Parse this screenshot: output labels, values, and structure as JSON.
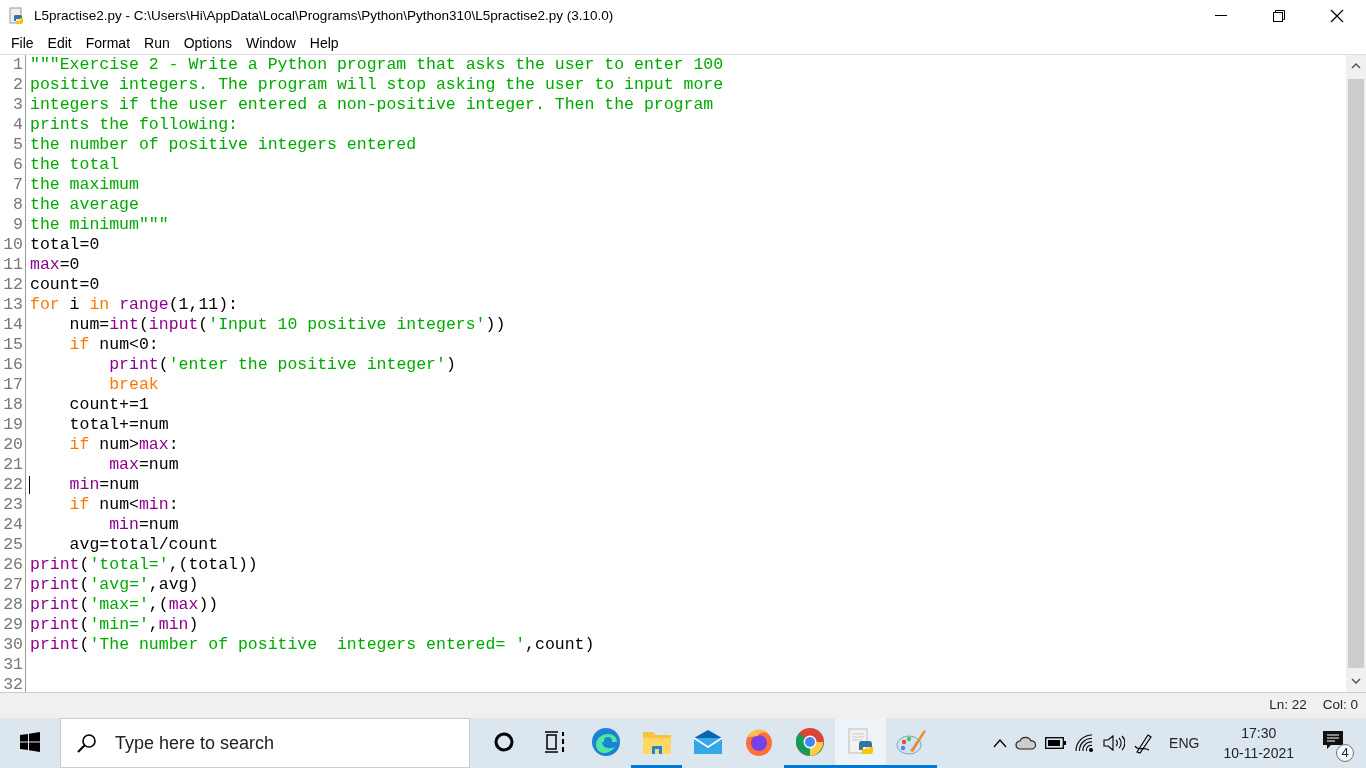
{
  "window": {
    "title": "L5practise2.py - C:\\Users\\Hi\\AppData\\Local\\Programs\\Python\\Python310\\L5practise2.py (3.10.0)"
  },
  "menu": [
    "File",
    "Edit",
    "Format",
    "Run",
    "Options",
    "Window",
    "Help"
  ],
  "editor": {
    "lines": [
      {
        "number": "1",
        "cursor": false,
        "tokens": [
          {
            "kind": "string",
            "text": "\"\"\"Exercise 2 - Write a Python program that asks the user to enter 100"
          }
        ]
      },
      {
        "number": "2",
        "cursor": false,
        "tokens": [
          {
            "kind": "string",
            "text": "positive integers. The program will stop asking the user to input more"
          }
        ]
      },
      {
        "number": "3",
        "cursor": false,
        "tokens": [
          {
            "kind": "string",
            "text": "integers if the user entered a non-positive integer. Then the program"
          }
        ]
      },
      {
        "number": "4",
        "cursor": false,
        "tokens": [
          {
            "kind": "string",
            "text": "prints the following:"
          }
        ]
      },
      {
        "number": "5",
        "cursor": false,
        "tokens": [
          {
            "kind": "string",
            "text": "the number of positive integers entered"
          }
        ]
      },
      {
        "number": "6",
        "cursor": false,
        "tokens": [
          {
            "kind": "string",
            "text": "the total"
          }
        ]
      },
      {
        "number": "7",
        "cursor": false,
        "tokens": [
          {
            "kind": "string",
            "text": "the maximum"
          }
        ]
      },
      {
        "number": "8",
        "cursor": false,
        "tokens": [
          {
            "kind": "string",
            "text": "the average"
          }
        ]
      },
      {
        "number": "9",
        "cursor": false,
        "tokens": [
          {
            "kind": "string",
            "text": "the minimum\"\"\""
          }
        ]
      },
      {
        "number": "10",
        "cursor": false,
        "tokens": [
          {
            "kind": "plain",
            "text": "total=0"
          }
        ]
      },
      {
        "number": "11",
        "cursor": false,
        "tokens": [
          {
            "kind": "builtin",
            "text": "max"
          },
          {
            "kind": "plain",
            "text": "=0"
          }
        ]
      },
      {
        "number": "12",
        "cursor": false,
        "tokens": [
          {
            "kind": "plain",
            "text": "count=0"
          }
        ]
      },
      {
        "number": "13",
        "cursor": false,
        "tokens": [
          {
            "kind": "keyword",
            "text": "for"
          },
          {
            "kind": "plain",
            "text": " i "
          },
          {
            "kind": "keyword",
            "text": "in"
          },
          {
            "kind": "builtin",
            "text": " range"
          },
          {
            "kind": "plain",
            "text": "(1,11):"
          }
        ]
      },
      {
        "number": "14",
        "cursor": false,
        "tokens": [
          {
            "kind": "plain",
            "text": "    num="
          },
          {
            "kind": "builtin",
            "text": "int"
          },
          {
            "kind": "plain",
            "text": "("
          },
          {
            "kind": "builtin",
            "text": "input"
          },
          {
            "kind": "plain",
            "text": "("
          },
          {
            "kind": "string",
            "text": "'Input 10 positive integers'"
          },
          {
            "kind": "plain",
            "text": "))"
          }
        ]
      },
      {
        "number": "15",
        "cursor": false,
        "tokens": [
          {
            "kind": "keyword",
            "text": "    if"
          },
          {
            "kind": "plain",
            "text": " num<0:"
          }
        ]
      },
      {
        "number": "16",
        "cursor": false,
        "tokens": [
          {
            "kind": "builtin",
            "text": "        print"
          },
          {
            "kind": "plain",
            "text": "("
          },
          {
            "kind": "string",
            "text": "'enter the positive integer'"
          },
          {
            "kind": "plain",
            "text": ")"
          }
        ]
      },
      {
        "number": "17",
        "cursor": false,
        "tokens": [
          {
            "kind": "keyword",
            "text": "        break"
          }
        ]
      },
      {
        "number": "18",
        "cursor": false,
        "tokens": [
          {
            "kind": "plain",
            "text": "    count+=1"
          }
        ]
      },
      {
        "number": "19",
        "cursor": false,
        "tokens": [
          {
            "kind": "plain",
            "text": "    total+=num"
          }
        ]
      },
      {
        "number": "20",
        "cursor": false,
        "tokens": [
          {
            "kind": "keyword",
            "text": "    if"
          },
          {
            "kind": "plain",
            "text": " num>"
          },
          {
            "kind": "builtin",
            "text": "max"
          },
          {
            "kind": "plain",
            "text": ":"
          }
        ]
      },
      {
        "number": "21",
        "cursor": false,
        "tokens": [
          {
            "kind": "builtin",
            "text": "        max"
          },
          {
            "kind": "plain",
            "text": "=num"
          }
        ]
      },
      {
        "number": "22",
        "cursor": true,
        "tokens": [
          {
            "kind": "builtin",
            "text": "    min"
          },
          {
            "kind": "plain",
            "text": "=num"
          }
        ]
      },
      {
        "number": "23",
        "cursor": false,
        "tokens": [
          {
            "kind": "keyword",
            "text": "    if"
          },
          {
            "kind": "plain",
            "text": " num<"
          },
          {
            "kind": "builtin",
            "text": "min"
          },
          {
            "kind": "plain",
            "text": ":"
          }
        ]
      },
      {
        "number": "24",
        "cursor": false,
        "tokens": [
          {
            "kind": "builtin",
            "text": "        min"
          },
          {
            "kind": "plain",
            "text": "=num"
          }
        ]
      },
      {
        "number": "25",
        "cursor": false,
        "tokens": [
          {
            "kind": "plain",
            "text": "    avg=total/count"
          }
        ]
      },
      {
        "number": "26",
        "cursor": false,
        "tokens": [
          {
            "kind": "builtin",
            "text": "print"
          },
          {
            "kind": "plain",
            "text": "("
          },
          {
            "kind": "string",
            "text": "'total='"
          },
          {
            "kind": "plain",
            "text": ",(total))"
          }
        ]
      },
      {
        "number": "27",
        "cursor": false,
        "tokens": [
          {
            "kind": "builtin",
            "text": "print"
          },
          {
            "kind": "plain",
            "text": "("
          },
          {
            "kind": "string",
            "text": "'avg='"
          },
          {
            "kind": "plain",
            "text": ",avg)"
          }
        ]
      },
      {
        "number": "28",
        "cursor": false,
        "tokens": [
          {
            "kind": "builtin",
            "text": "print"
          },
          {
            "kind": "plain",
            "text": "("
          },
          {
            "kind": "string",
            "text": "'max='"
          },
          {
            "kind": "plain",
            "text": ",("
          },
          {
            "kind": "builtin",
            "text": "max"
          },
          {
            "kind": "plain",
            "text": "))"
          }
        ]
      },
      {
        "number": "29",
        "cursor": false,
        "tokens": [
          {
            "kind": "builtin",
            "text": "print"
          },
          {
            "kind": "plain",
            "text": "("
          },
          {
            "kind": "string",
            "text": "'min='"
          },
          {
            "kind": "plain",
            "text": ","
          },
          {
            "kind": "builtin",
            "text": "min"
          },
          {
            "kind": "plain",
            "text": ")"
          }
        ]
      },
      {
        "number": "30",
        "cursor": false,
        "tokens": [
          {
            "kind": "builtin",
            "text": "print"
          },
          {
            "kind": "plain",
            "text": "("
          },
          {
            "kind": "string",
            "text": "'The number of positive  integers entered= '"
          },
          {
            "kind": "plain",
            "text": ",count)"
          }
        ]
      },
      {
        "number": "31",
        "cursor": false
      },
      {
        "number": "32",
        "cursor": false
      }
    ]
  },
  "status_bar": {
    "line": "Ln: 22",
    "column": "Col: 0"
  },
  "taskbar": {
    "search": {
      "placeholder": "Type here to search"
    },
    "apps": [
      {
        "kind": "cortana",
        "running": false,
        "selected": false
      },
      {
        "kind": "taskview",
        "running": false,
        "selected": false
      },
      {
        "kind": "edge",
        "running": false,
        "selected": false
      },
      {
        "kind": "explorer",
        "running": true,
        "selected": false
      },
      {
        "kind": "mail",
        "running": false,
        "selected": false
      },
      {
        "kind": "firefox",
        "running": false,
        "selected": false
      },
      {
        "kind": "chrome",
        "running": true,
        "selected": false
      },
      {
        "kind": "idle",
        "running": true,
        "selected": true
      },
      {
        "kind": "paint",
        "running": true,
        "selected": false
      }
    ],
    "language": "ENG",
    "time": "17:30",
    "date": "10-11-2021",
    "notification_count": "4"
  }
}
